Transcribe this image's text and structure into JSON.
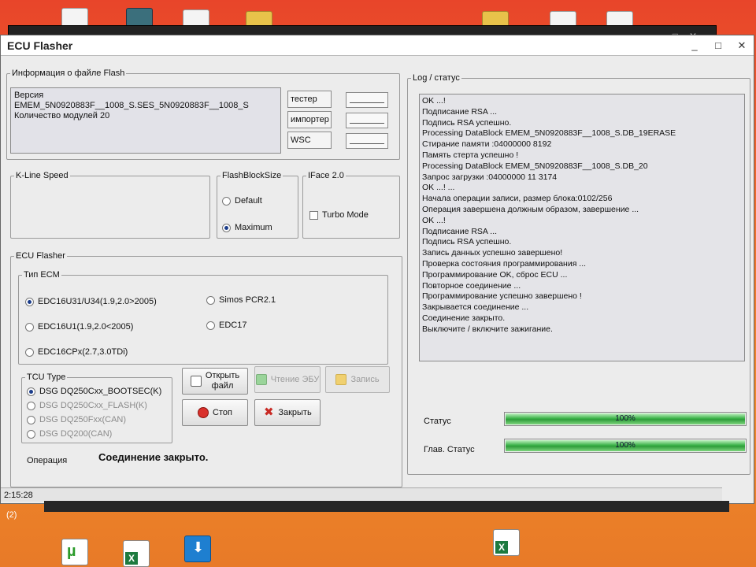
{
  "window": {
    "title": "ECU Flasher",
    "controls": [
      "_",
      "□",
      "✕"
    ]
  },
  "background_window": {
    "controls": [
      "_",
      "□",
      "✕"
    ]
  },
  "file_info": {
    "legend": "Информация  о файле Flash",
    "lines": [
      "Версия",
      "EMEM_5N0920883F__1008_S.SES_5N0920883F__1008_S",
      "Количество модулей 20"
    ],
    "tags": [
      {
        "label": "тестер"
      },
      {
        "label": "импортер"
      },
      {
        "label": "WSC"
      }
    ]
  },
  "kline": {
    "legend": "K-Line Speed"
  },
  "flash_block_size": {
    "legend": "FlashBlockSize",
    "options": [
      {
        "label": "Default",
        "selected": false
      },
      {
        "label": "Maximum",
        "selected": true
      }
    ]
  },
  "iface": {
    "legend": "IFace 2.0",
    "turbo_label": "Turbo Mode",
    "turbo_checked": false
  },
  "ecu_flasher": {
    "legend": "ECU Flasher",
    "ecm_type": {
      "legend": "Тип ECM",
      "options": [
        {
          "label": "EDC16U31/U34(1.9,2.0>2005)",
          "selected": true,
          "enabled": true
        },
        {
          "label": "EDC16U1(1.9,2.0<2005)",
          "selected": false,
          "enabled": true
        },
        {
          "label": "EDC16CPx(2.7,3.0TDi)",
          "selected": false,
          "enabled": true
        },
        {
          "label": "Simos PCR2.1",
          "selected": false,
          "enabled": true
        },
        {
          "label": "EDC17",
          "selected": false,
          "enabled": true
        }
      ]
    },
    "tcu_type": {
      "legend": "TCU Type",
      "options": [
        {
          "label": "DSG DQ250Cxx_BOOTSEC(K)",
          "selected": true,
          "enabled": true
        },
        {
          "label": "DSG DQ250Cxx_FLASH(K)",
          "selected": false,
          "enabled": false
        },
        {
          "label": "DSG DQ250Fxx(CAN)",
          "selected": false,
          "enabled": false
        },
        {
          "label": "DSG DQ200(CAN)",
          "selected": false,
          "enabled": false
        }
      ]
    },
    "buttons": {
      "open_line1": "Открыть",
      "open_line2": "файл",
      "read": "Чтение ЭБУ",
      "write": "Запись",
      "stop": "Стоп",
      "close": "Закрыть"
    },
    "operation_label": "Операция",
    "operation_value": "Соединение закрыто."
  },
  "log": {
    "legend": "Log / статус",
    "lines": [
      "OK ...!",
      "Подписание RSA ...",
      "Подпись RSA успешно.",
      "Processing DataBlock EMEM_5N0920883F__1008_S.DB_19ERASE",
      "Стирание памяти :04000000 8192",
      "Память стерта успешно !",
      "Processing DataBlock EMEM_5N0920883F__1008_S.DB_20",
      "Запрос загрузки :04000000 11 3174",
      "OK ...! ...",
      "Начала операции записи, размер блока:0102/256",
      "Операция завершена должным образом, завершение ...",
      "OK ...!",
      "Подписание RSA ...",
      "Подпись RSA успешно.",
      "Запись данных успешно завершено!",
      "Проверка состояния программирования ...",
      "Программирование OK, сброс ECU ...",
      "Повторное соединение ...",
      "Программирование успешно завершено !",
      "Закрывается соединение ...",
      "Соединение закрыто.",
      "Выключите / включите зажигание."
    ]
  },
  "status": {
    "status_label": "Статус",
    "status_progress": 100,
    "status_text": "100%",
    "main_label": "Глав. Статус",
    "main_progress": 100,
    "main_text": "100%"
  },
  "statusbar": {
    "time": "2:15:28"
  },
  "taskbar": {
    "badge": "(2)"
  },
  "desktop_icons": [
    "file-icon",
    "photo-icon",
    "file-icon",
    "folder-icon",
    "folder-icon",
    "file-icon",
    "file-icon",
    "torrent-icon",
    "excel-icon",
    "download-icon",
    "excel-icon"
  ]
}
